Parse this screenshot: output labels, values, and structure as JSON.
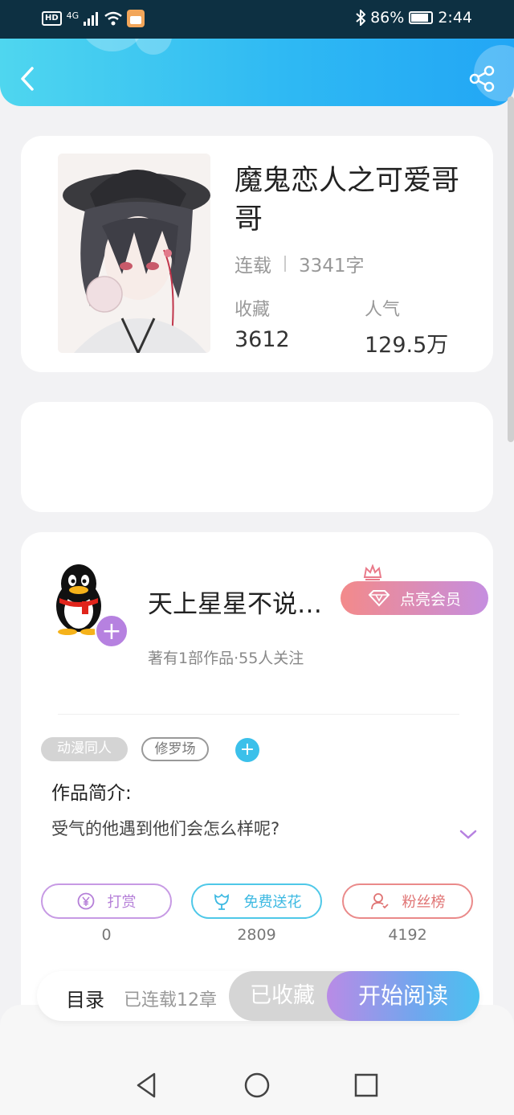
{
  "status_bar": {
    "hd": "HD",
    "network": "4G",
    "battery": "86%",
    "time": "2:44"
  },
  "book": {
    "title": "魔鬼恋人之可爱哥哥",
    "status": "连载",
    "word_count": "3341字",
    "collect_label": "收藏",
    "collect_value": "3612",
    "popularity_label": "人气",
    "popularity_value": "129.5万"
  },
  "author": {
    "name": "天上星星不说…",
    "meta": "著有1部作品·55人关注",
    "follow_symbol": "+",
    "vip_label": "点亮会员"
  },
  "tags": {
    "items": [
      "动漫同人",
      "修罗场"
    ],
    "add_symbol": "+"
  },
  "intro": {
    "title": "作品简介:",
    "text": "受气的他遇到他们会怎么样呢?"
  },
  "actions": [
    {
      "label": "打赏",
      "count": "0",
      "icon": "yen-coin-icon"
    },
    {
      "label": "免费送花",
      "count": "2809",
      "icon": "flower-icon"
    },
    {
      "label": "粉丝榜",
      "count": "4192",
      "icon": "fans-icon"
    }
  ],
  "bottom_bar": {
    "toc_label": "目录",
    "chapter_count": "已连载12章",
    "collected_label": "已收藏",
    "read_label": "开始阅读"
  },
  "colors": {
    "header_start": "#4fd6ef",
    "header_end": "#22a6f5",
    "purple_accent": "#b681e0",
    "cyan_accent": "#3bc0ea",
    "red_accent": "#e07474"
  }
}
